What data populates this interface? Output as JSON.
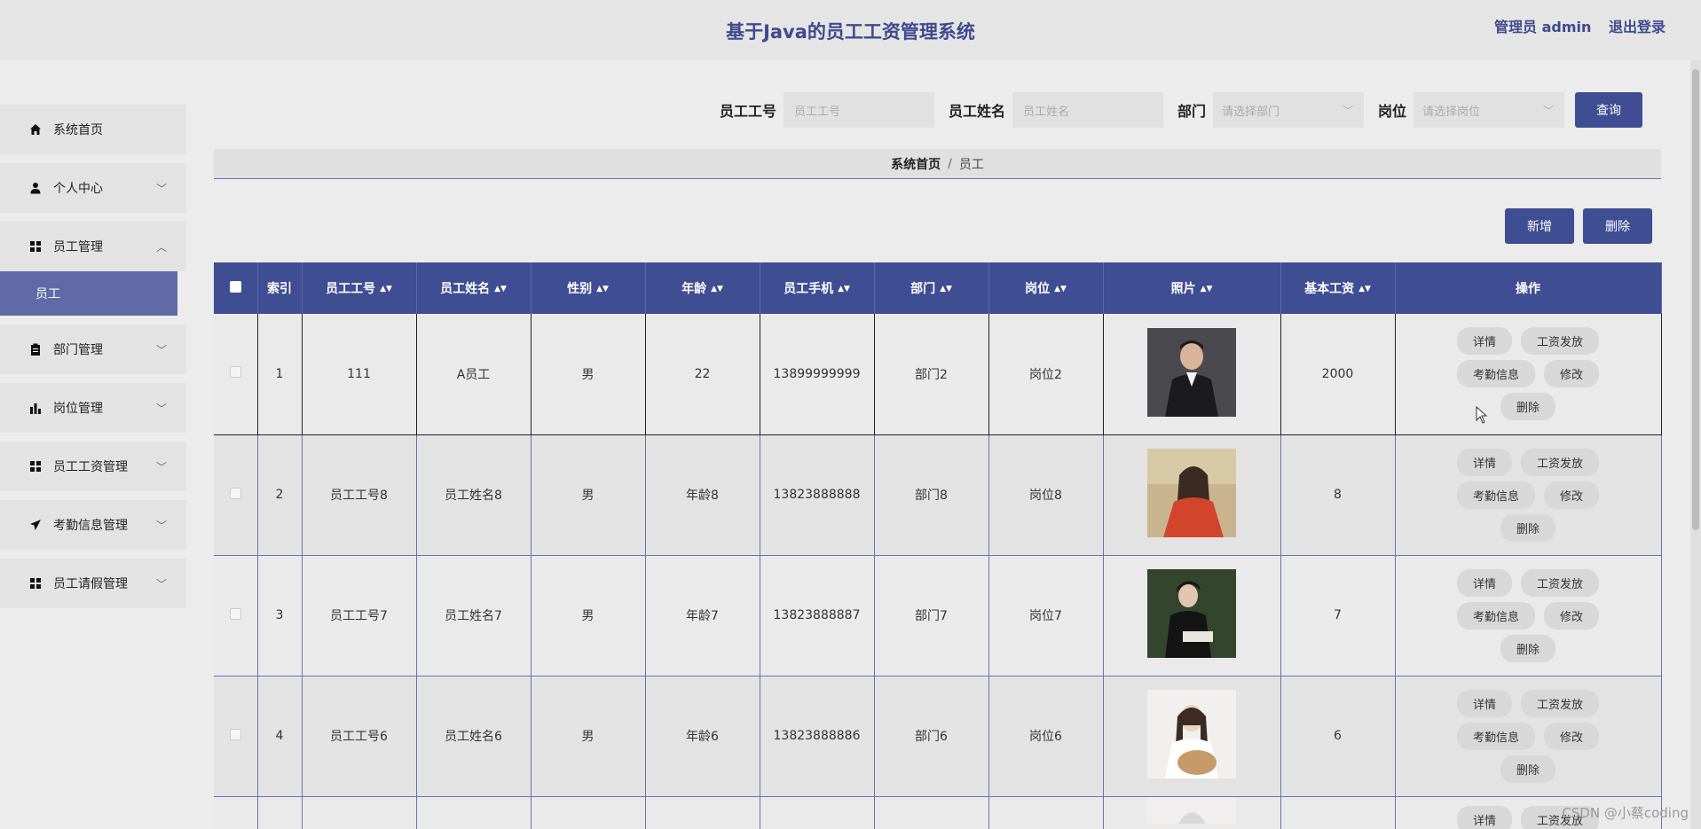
{
  "header": {
    "title": "基于Java的员工工资管理系统",
    "user_label": "管理员 admin",
    "logout_label": "退出登录"
  },
  "sidebar": {
    "items": [
      {
        "label": "系统首页",
        "icon": "home-icon",
        "expandable": false
      },
      {
        "label": "个人中心",
        "icon": "user-icon",
        "expandable": true
      },
      {
        "label": "员工管理",
        "icon": "grid-icon",
        "expandable": true,
        "open": true,
        "sub": [
          {
            "label": "员工",
            "active": true
          }
        ]
      },
      {
        "label": "部门管理",
        "icon": "clipboard-icon",
        "expandable": true
      },
      {
        "label": "岗位管理",
        "icon": "bar-chart-icon",
        "expandable": true
      },
      {
        "label": "员工工资管理",
        "icon": "grid-icon",
        "expandable": true
      },
      {
        "label": "考勤信息管理",
        "icon": "send-icon",
        "expandable": true
      },
      {
        "label": "员工请假管理",
        "icon": "grid-icon",
        "expandable": true
      }
    ]
  },
  "search": {
    "emp_no_label": "员工工号",
    "emp_no_placeholder": "员工工号",
    "emp_name_label": "员工姓名",
    "emp_name_placeholder": "员工姓名",
    "dept_label": "部门",
    "dept_placeholder": "请选择部门",
    "post_label": "岗位",
    "post_placeholder": "请选择岗位",
    "query_label": "查询"
  },
  "breadcrumb": {
    "home": "系统首页",
    "separator": "/",
    "current": "员工"
  },
  "actions": {
    "add_label": "新增",
    "delete_label": "删除"
  },
  "table": {
    "columns": [
      "索引",
      "员工工号",
      "员工姓名",
      "性别",
      "年龄",
      "员工手机",
      "部门",
      "岗位",
      "照片",
      "基本工资",
      "操作"
    ],
    "sortable": [
      false,
      true,
      true,
      true,
      true,
      true,
      true,
      true,
      true,
      true,
      false
    ],
    "rows": [
      {
        "index": "1",
        "emp_no": "111",
        "name": "A员工",
        "gender": "男",
        "age": "22",
        "phone": "13899999999",
        "dept": "部门2",
        "post": "岗位2",
        "salary": "2000"
      },
      {
        "index": "2",
        "emp_no": "员工工号8",
        "name": "员工姓名8",
        "gender": "男",
        "age": "年龄8",
        "phone": "13823888888",
        "dept": "部门8",
        "post": "岗位8",
        "salary": "8"
      },
      {
        "index": "3",
        "emp_no": "员工工号7",
        "name": "员工姓名7",
        "gender": "男",
        "age": "年龄7",
        "phone": "13823888887",
        "dept": "部门7",
        "post": "岗位7",
        "salary": "7"
      },
      {
        "index": "4",
        "emp_no": "员工工号6",
        "name": "员工姓名6",
        "gender": "男",
        "age": "年龄6",
        "phone": "13823888886",
        "dept": "部门6",
        "post": "岗位6",
        "salary": "6"
      }
    ],
    "row_ops": {
      "detail": "详情",
      "pay": "工资发放",
      "attendance": "考勤信息",
      "edit": "修改",
      "delete": "删除"
    }
  },
  "watermark": "CSDN @小蔡coding",
  "colors": {
    "primary": "#3f4d93",
    "active_submenu": "#5f6aa6",
    "background": "#ececec"
  }
}
